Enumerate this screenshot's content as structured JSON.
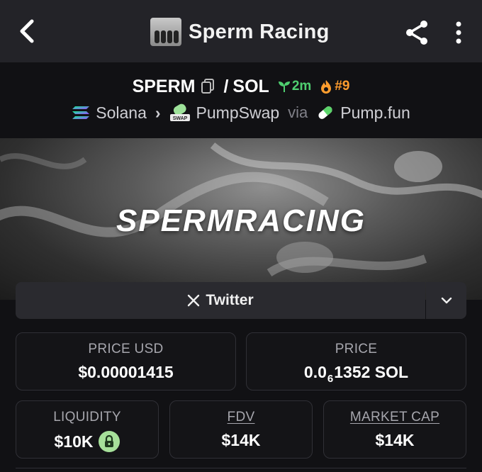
{
  "header": {
    "title": "Sperm Racing",
    "back_icon": "chevron-left-icon",
    "share_icon": "share-icon",
    "more_icon": "more-vertical-icon"
  },
  "pair": {
    "base": "SPERM",
    "separator": "/",
    "quote": "SOL",
    "age": "2m",
    "rank": "#9"
  },
  "route": {
    "chain": "Solana",
    "dex": "PumpSwap",
    "dex_badge": "SWAP",
    "via": "via",
    "launchpad": "Pump.fun"
  },
  "banner": {
    "text": "SPERMRACING"
  },
  "social": {
    "twitter_label": "Twitter"
  },
  "stats": {
    "price_usd_label": "PRICE USD",
    "price_usd_value": "$0.00001415",
    "price_label": "PRICE",
    "price_prefix": "0.0",
    "price_zero_count": "6",
    "price_suffix": "1352 SOL",
    "liquidity_label": "LIQUIDITY",
    "liquidity_value": "$10K",
    "fdv_label": "FDV",
    "fdv_value": "$14K",
    "mcap_label": "MARKET CAP",
    "mcap_value": "$14K"
  },
  "colors": {
    "background": "#111114",
    "header_bg": "#232328",
    "age_green": "#4fcf70",
    "rank_orange": "#ff9d2e",
    "lock_green": "#a6e09a"
  }
}
